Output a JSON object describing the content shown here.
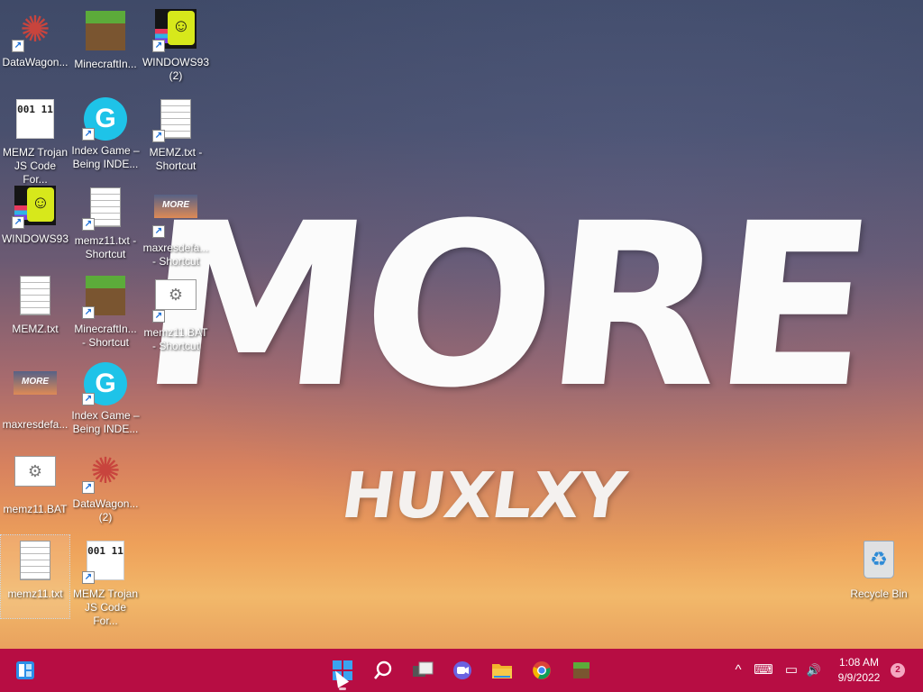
{
  "wallpaper": {
    "title": "MORE",
    "subtitle": "HUXLXY"
  },
  "desktop_icons": [
    {
      "label": "DataWagon...",
      "icon": "datawagon-icon",
      "shortcut": true
    },
    {
      "label": "MinecraftIn...",
      "icon": "minecraft-icon",
      "shortcut": false
    },
    {
      "label": "WINDOWS93 (2)",
      "icon": "windows93-icon",
      "shortcut": true
    },
    {
      "label": "MEMZ Trojan JS Code For...",
      "icon": "binary-file-icon",
      "shortcut": false
    },
    {
      "label": "Index Game – Being INDE...",
      "icon": "index-game-icon",
      "shortcut": true
    },
    {
      "label": "MEMZ.txt - Shortcut",
      "icon": "text-file-icon",
      "shortcut": true
    },
    {
      "label": "WINDOWS93",
      "icon": "windows93-icon",
      "shortcut": true
    },
    {
      "label": "memz11.txt - Shortcut",
      "icon": "text-file-icon",
      "shortcut": true
    },
    {
      "label": "maxresdefa... - Shortcut",
      "icon": "image-more-icon",
      "shortcut": true
    },
    {
      "label": "MEMZ.txt",
      "icon": "text-file-icon",
      "shortcut": false
    },
    {
      "label": "MinecraftIn... - Shortcut",
      "icon": "minecraft-icon",
      "shortcut": true
    },
    {
      "label": "memz11.BAT - Shortcut",
      "icon": "batch-file-icon",
      "shortcut": true
    },
    {
      "label": "maxresdefa...",
      "icon": "image-more-icon",
      "shortcut": false
    },
    {
      "label": "Index Game – Being INDE...",
      "icon": "index-game-icon",
      "shortcut": true
    },
    {
      "label": "memz11.BAT",
      "icon": "batch-file-icon",
      "shortcut": false
    },
    {
      "label": "DataWagon... (2)",
      "icon": "datawagon-icon",
      "shortcut": true
    },
    {
      "label": "memz11.txt",
      "icon": "text-file-icon",
      "shortcut": false,
      "selected": true
    },
    {
      "label": "MEMZ Trojan JS Code For...",
      "icon": "binary-file-icon",
      "shortcut": true
    },
    {
      "label": "Recycle Bin",
      "icon": "recycle-bin-icon",
      "shortcut": false
    }
  ],
  "glyphs": {
    "binary": "001 11",
    "index": "G",
    "windows93_face": "☺",
    "more_thumb": "MORE",
    "gear": "⚙",
    "recycle": "♻",
    "datawagon": "✺"
  },
  "taskbar": {
    "color": "#b70d43",
    "icons": [
      "widgets-icon",
      "start-icon",
      "search-icon",
      "task-view-icon",
      "chat-icon",
      "file-explorer-icon",
      "chrome-icon",
      "minecraft-icon"
    ],
    "tray": {
      "chevron": "^",
      "keyboard": "⌨",
      "network": "▭",
      "volume": "🔊"
    },
    "clock": {
      "time": "1:08 AM",
      "date": "9/9/2022"
    },
    "notification_count": "2"
  }
}
